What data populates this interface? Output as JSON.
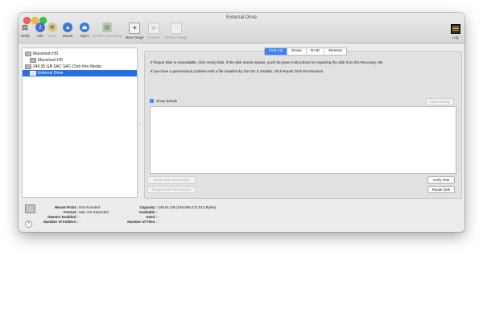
{
  "window": {
    "title": "External Drive"
  },
  "toolbar": {
    "items": [
      {
        "label": "Verify",
        "icon": "microscope-icon",
        "enabled": true
      },
      {
        "label": "Info",
        "icon": "info-icon",
        "enabled": true
      },
      {
        "label": "Burn",
        "icon": "burn-icon",
        "enabled": false
      },
      {
        "label": "Mount",
        "icon": "mount-icon",
        "enabled": true
      },
      {
        "label": "Eject",
        "icon": "eject-icon",
        "enabled": true
      },
      {
        "label": "Enable Journaling",
        "icon": "journal-icon",
        "enabled": false
      },
      {
        "label": "New Image",
        "icon": "new-image-icon",
        "enabled": true
      },
      {
        "label": "Convert",
        "icon": "convert-icon",
        "enabled": false
      },
      {
        "label": "Resize Image",
        "icon": "resize-image-icon",
        "enabled": false
      }
    ],
    "log_label": "Log"
  },
  "sidebar": {
    "items": [
      {
        "label": "Macintosh HD",
        "selected": false
      },
      {
        "label": "Macintosh HD",
        "selected": false
      },
      {
        "label": "249.95 GB SAC SAC-Click free Media",
        "selected": false
      },
      {
        "label": "External Drive",
        "selected": true
      }
    ]
  },
  "tabs": [
    {
      "label": "First Aid",
      "active": true
    },
    {
      "label": "Erase",
      "active": false
    },
    {
      "label": "RAID",
      "active": false
    },
    {
      "label": "Restore",
      "active": false
    }
  ],
  "first_aid": {
    "line1": "If Repair Disk is unavailable, click Verify Disk. If the disk needs repairs, you'll be given instructions for repairing the disk from the Recovery HD.",
    "line2": "If you have a permissions problem with a file installed by the OS X installer, click Repair Disk Permissions.",
    "show_details_label": "Show details",
    "show_details_checked": true,
    "clear_history_label": "Clear History",
    "verify_permissions_label": "Verify Disk Permissions",
    "repair_permissions_label": "Repair Disk Permissions",
    "verify_disk_label": "Verify Disk",
    "repair_disk_label": "Repair Disk"
  },
  "info": {
    "left": [
      {
        "key": "Mount Point :",
        "value": "Not mounted"
      },
      {
        "key": "Format :",
        "value": "Mac OS Extended"
      },
      {
        "key": "Owners Enabled :",
        "value": "-"
      },
      {
        "key": "Number of Folders :",
        "value": "-"
      }
    ],
    "right": [
      {
        "key": "Capacity :",
        "value": "249.51 GB (249,509,472,512 Bytes)"
      },
      {
        "key": "Available :",
        "value": "-"
      },
      {
        "key": "Used :",
        "value": "-"
      },
      {
        "key": "Number of Files :",
        "value": "-"
      }
    ]
  },
  "colors": {
    "accent": "#3b82f7",
    "selection": "#2a6fe0"
  }
}
